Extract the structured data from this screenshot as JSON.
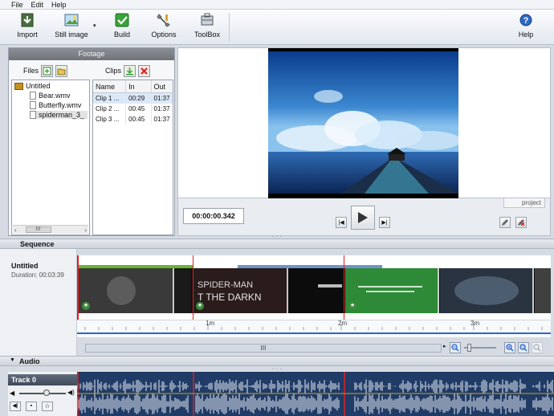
{
  "menu": [
    "File",
    "Edit",
    "Help"
  ],
  "toolbar": {
    "import": "Import",
    "still_image": "Still image",
    "build": "Build",
    "options": "Options",
    "toolbox": "ToolBox",
    "help": "Help"
  },
  "footage": {
    "title": "Footage",
    "files_label": "Files",
    "clips_label": "Clips",
    "tree_root": "Untitled",
    "files": [
      "Bear.wmv",
      "Butterfly.wmv",
      "spiderman_3_"
    ],
    "selected_file_index": 2,
    "scroll_thumb": "III",
    "clip_columns": [
      "Name",
      "In",
      "Out"
    ],
    "clips": [
      {
        "name": "Clip 1 ...",
        "in": "00:29",
        "out": "01:37"
      },
      {
        "name": "Clip 2 ...",
        "in": "00:45",
        "out": "01:37"
      },
      {
        "name": "Clip 3 ...",
        "in": "00:45",
        "out": "01:37"
      }
    ]
  },
  "preview": {
    "timecode": "00:00:00.342",
    "project_tab": "project"
  },
  "sequence": {
    "header": "Sequence",
    "title": "Untitled",
    "duration": "Duration: 00:03:39",
    "ruler": [
      "1m",
      "2m",
      "3m"
    ],
    "scroll_thumb": "III",
    "thumb_text_1": "SPIDER-MAN",
    "thumb_text_2": "T THE DARKN"
  },
  "audio": {
    "header": "Audio",
    "track": "Track 0"
  },
  "colors": {
    "accent": "#2c66c7",
    "build_green": "#3aa33a",
    "playhead_red": "#e02020",
    "wave_bg": "#1f3b66"
  }
}
